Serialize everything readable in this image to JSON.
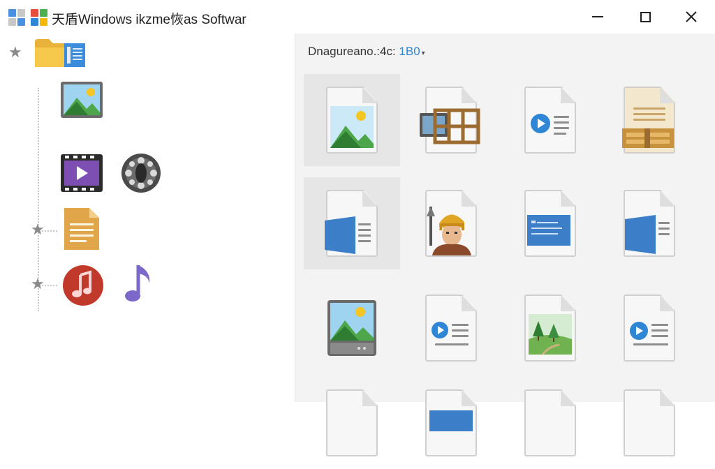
{
  "window": {
    "title": "天盾Windows ikzme恢as Softwar",
    "logo_colors": [
      "#4a90e2",
      "#bbbbbb",
      "#bbbbbb",
      "#4a90e2"
    ],
    "logo2_colors": [
      "#e74c3c",
      "#4caf50",
      "#2e86d4",
      "#f5b800"
    ]
  },
  "controls": {
    "minimize": "—",
    "maximize": "☐",
    "close": "✕"
  },
  "path": {
    "prefix": "Dnagureano.:4c: ",
    "value": "1B0",
    "caret": "▾"
  },
  "icons": {
    "tree": [
      "folder-icon",
      "image-icon",
      "video-icon",
      "film-reel-icon",
      "document-icon",
      "music-icon",
      "music-note-icon"
    ],
    "star": "★"
  },
  "colors": {
    "accent": "#2e86d4",
    "folder": "#f6c84c",
    "video": "#7e4fb3",
    "music": "#c0392b",
    "note": "#7b68c8"
  }
}
